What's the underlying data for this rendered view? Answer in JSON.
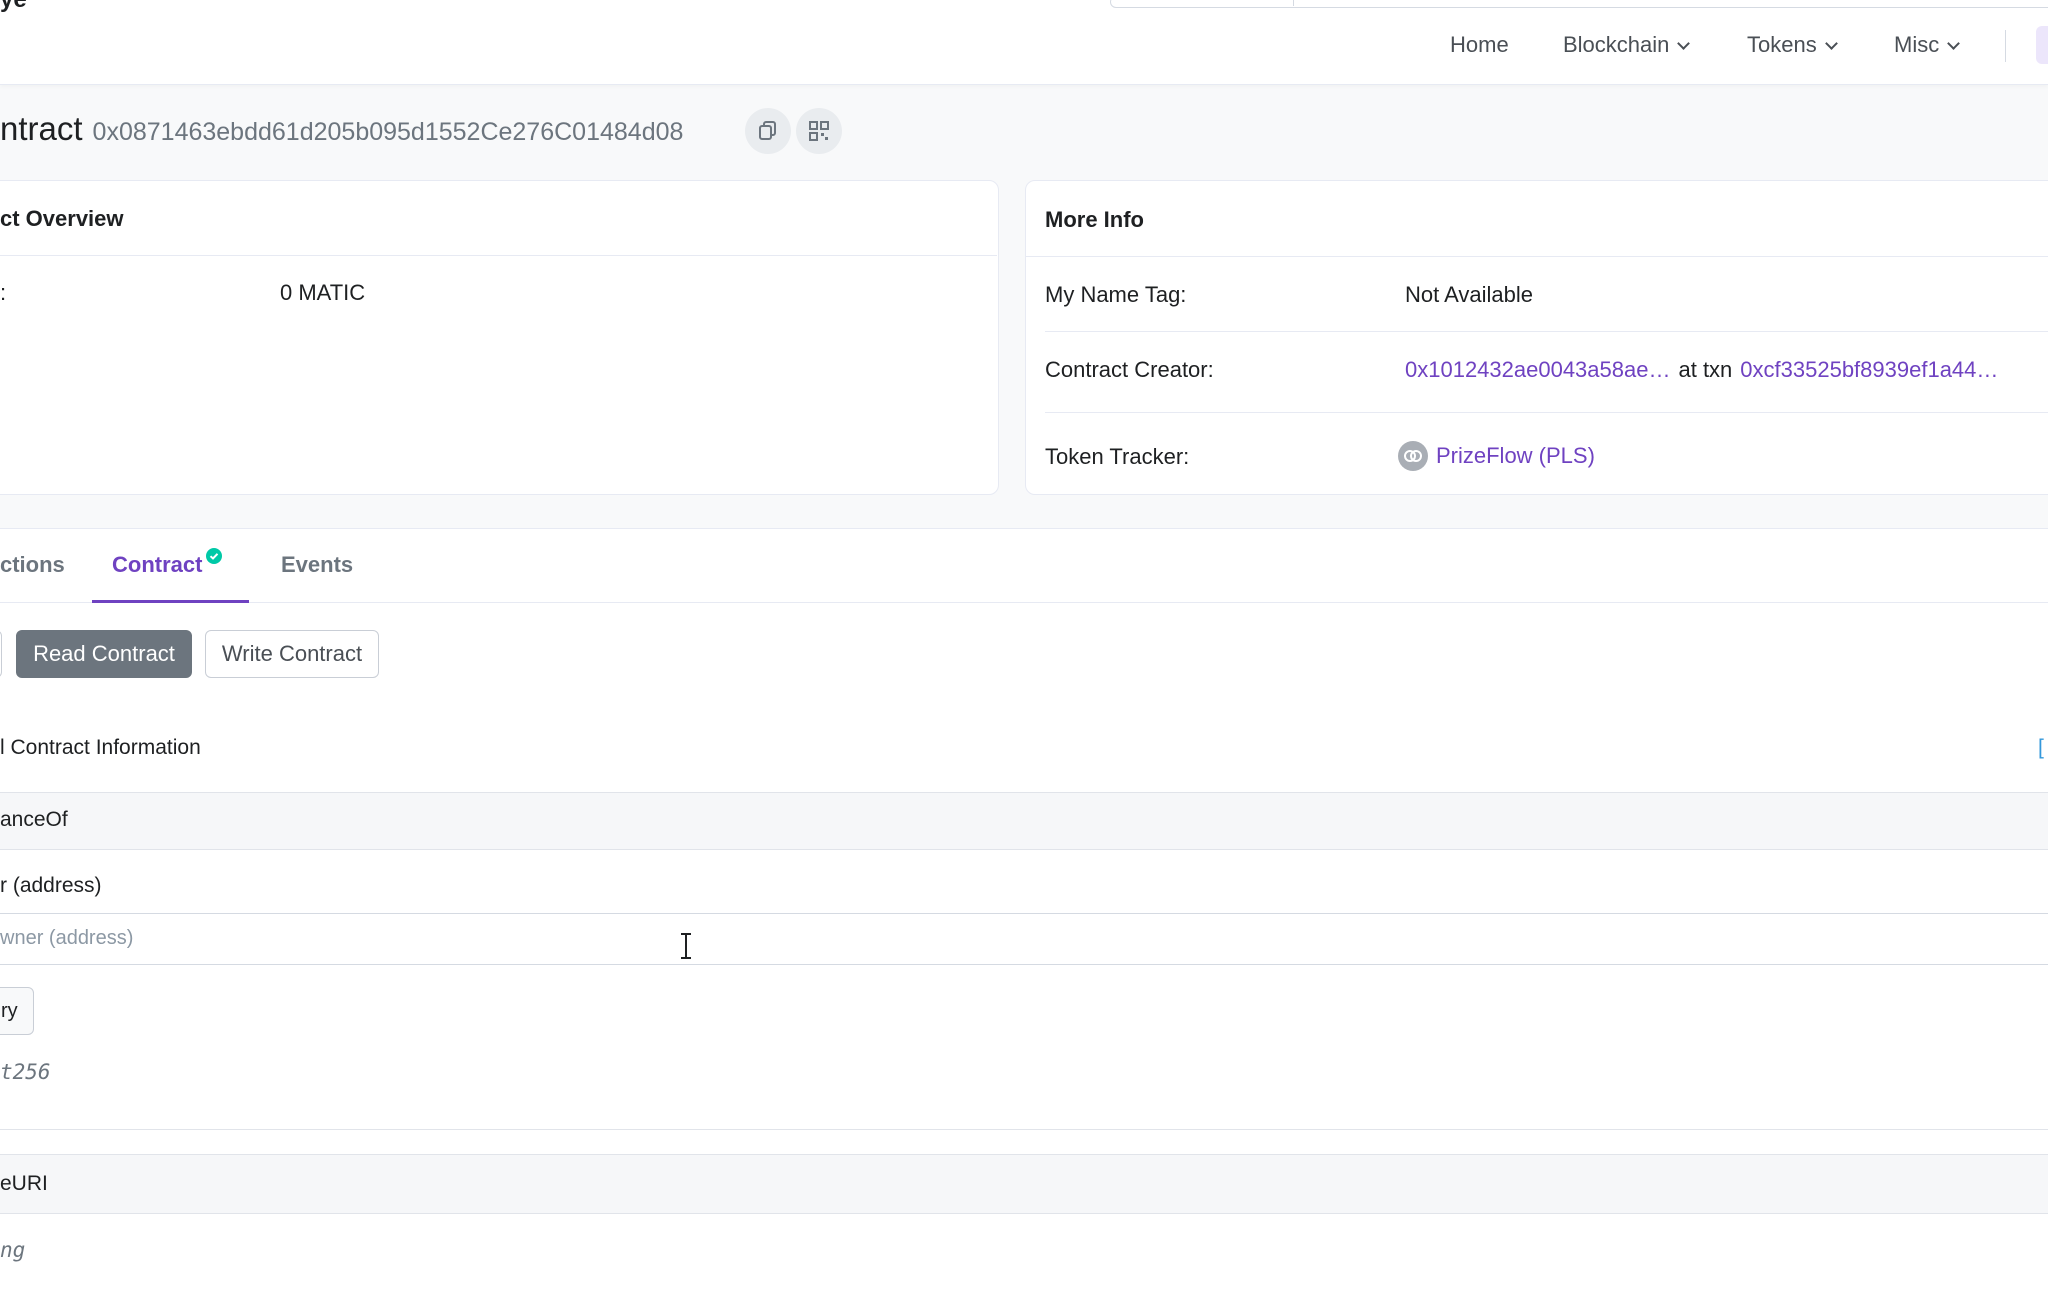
{
  "header": {
    "logo_fragment": "ye",
    "nav": [
      {
        "label": "Home",
        "has_dropdown": false
      },
      {
        "label": "Blockchain",
        "has_dropdown": true
      },
      {
        "label": "Tokens",
        "has_dropdown": true
      },
      {
        "label": "Misc",
        "has_dropdown": true
      }
    ]
  },
  "page": {
    "title_fragment": "ntract",
    "address": "0x0871463ebdd61d205b095d1552Ce276C01484d08"
  },
  "overview": {
    "title": "ct Overview",
    "balance_label": ":",
    "balance_value": "0 MATIC"
  },
  "more_info": {
    "title": "More Info",
    "name_tag_label": "My Name Tag:",
    "name_tag_value": "Not Available",
    "creator_label": "Contract Creator:",
    "creator_address": "0x1012432ae0043a58ae…",
    "creator_at_txn": "at txn",
    "creator_txn": "0xcf33525bf8939ef1a44…",
    "token_tracker_label": "Token Tracker:",
    "token_tracker_value": "PrizeFlow (PLS)"
  },
  "tabs": {
    "items": [
      "ctions",
      "Contract",
      "Events"
    ],
    "active": "Contract"
  },
  "contract_buttons": {
    "read": "Read Contract",
    "write": "Write Contract"
  },
  "contract_info": {
    "heading": "l Contract Information",
    "right_link_fragment": "[",
    "functions": [
      {
        "name": "anceOf",
        "param_label": "r (address)",
        "placeholder": "wner (address)",
        "query_label": "ry",
        "return_type": "t256"
      },
      {
        "name": "eURI",
        "return_type": "ng"
      }
    ]
  },
  "colors": {
    "accent": "#6f42c1",
    "verified": "#00c9a7",
    "read_button": "#6c757e"
  }
}
